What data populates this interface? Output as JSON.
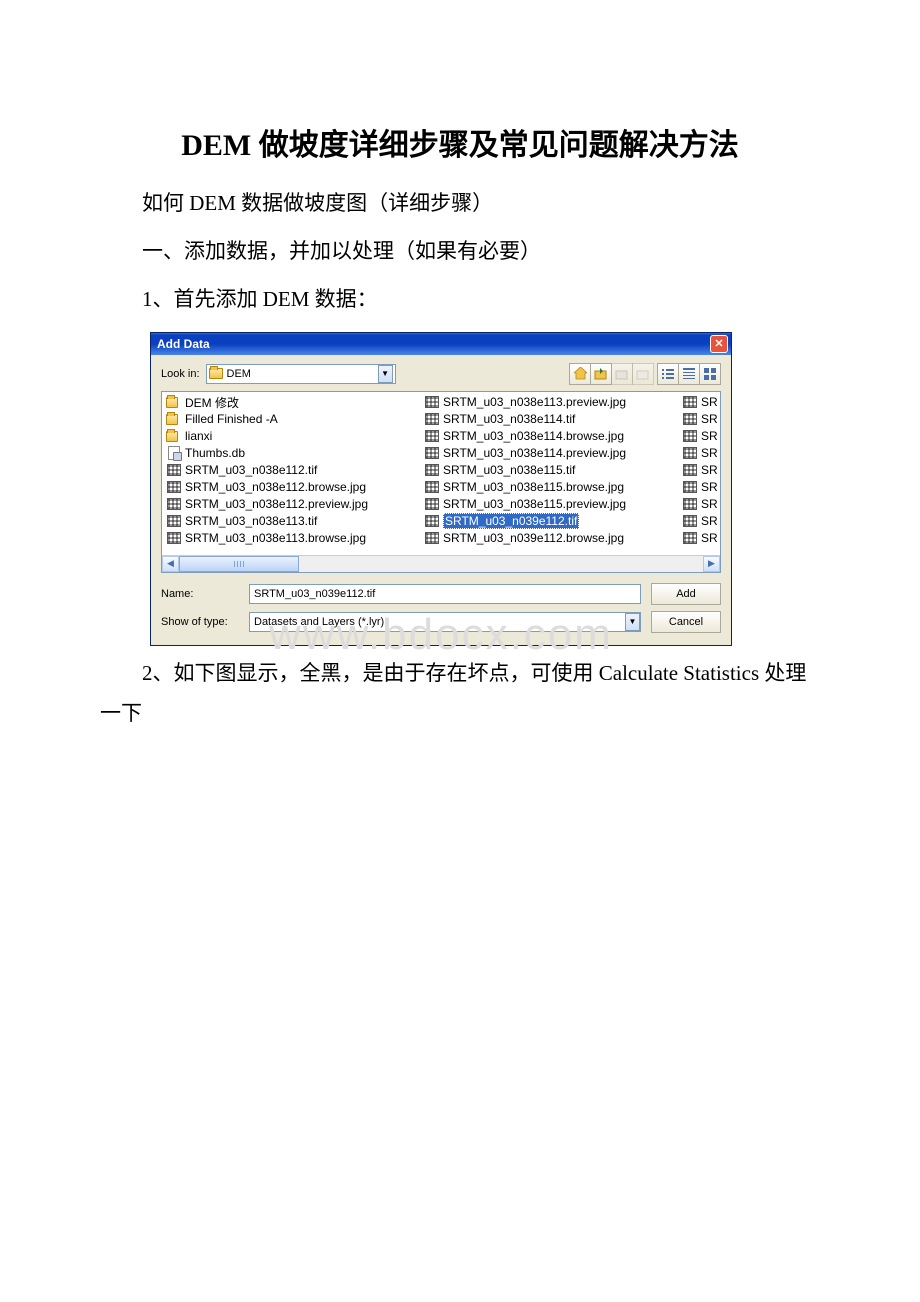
{
  "doc": {
    "title": "DEM 做坡度详细步骤及常见问题解决方法",
    "p1": "如何 DEM 数据做坡度图（详细步骤）",
    "p2": "一、添加数据，并加以处理（如果有必要）",
    "p3": "1、首先添加 DEM 数据：",
    "p4": "2、如下图显示，全黑，是由于存在坏点，可使用 Calculate Statistics 处理一下"
  },
  "watermark": "www.bdocx.com",
  "dialog": {
    "title": "Add Data",
    "lookin_label": "Look in:",
    "lookin_value": "DEM",
    "name_label": "Name:",
    "name_value": "SRTM_u03_n039e112.tif",
    "type_label": "Show of type:",
    "type_value": "Datasets and Layers (*.lyr)",
    "add": "Add",
    "cancel": "Cancel",
    "toolbar": {
      "up": "up-one-level-icon",
      "connect": "connect-folder-icon",
      "disconnect": "disconnect-folder-icon",
      "new": "new-folder-icon",
      "list": "list-view-icon",
      "details": "details-view-icon",
      "thumbs": "thumbnails-view-icon"
    },
    "files_col1": [
      {
        "icon": "folder",
        "name": "DEM 修改"
      },
      {
        "icon": "folder",
        "name": "Filled Finished -A"
      },
      {
        "icon": "folder",
        "name": "lianxi"
      },
      {
        "icon": "db",
        "name": "Thumbs.db"
      },
      {
        "icon": "raster",
        "name": "SRTM_u03_n038e112.tif"
      },
      {
        "icon": "raster",
        "name": "SRTM_u03_n038e112.browse.jpg"
      },
      {
        "icon": "raster",
        "name": "SRTM_u03_n038e112.preview.jpg"
      },
      {
        "icon": "raster",
        "name": "SRTM_u03_n038e113.tif"
      },
      {
        "icon": "raster",
        "name": "SRTM_u03_n038e113.browse.jpg"
      }
    ],
    "files_col2": [
      {
        "icon": "raster",
        "name": "SRTM_u03_n038e113.preview.jpg"
      },
      {
        "icon": "raster",
        "name": "SRTM_u03_n038e114.tif"
      },
      {
        "icon": "raster",
        "name": "SRTM_u03_n038e114.browse.jpg"
      },
      {
        "icon": "raster",
        "name": "SRTM_u03_n038e114.preview.jpg"
      },
      {
        "icon": "raster",
        "name": "SRTM_u03_n038e115.tif"
      },
      {
        "icon": "raster",
        "name": "SRTM_u03_n038e115.browse.jpg"
      },
      {
        "icon": "raster",
        "name": "SRTM_u03_n038e115.preview.jpg"
      },
      {
        "icon": "raster",
        "name": "SRTM_u03_n039e112.tif",
        "selected": true
      },
      {
        "icon": "raster",
        "name": "SRTM_u03_n039e112.browse.jpg"
      }
    ],
    "files_col3": [
      {
        "icon": "raster",
        "name": "SR"
      },
      {
        "icon": "raster",
        "name": "SR"
      },
      {
        "icon": "raster",
        "name": "SR"
      },
      {
        "icon": "raster",
        "name": "SR"
      },
      {
        "icon": "raster",
        "name": "SR"
      },
      {
        "icon": "raster",
        "name": "SR"
      },
      {
        "icon": "raster",
        "name": "SR"
      },
      {
        "icon": "raster",
        "name": "SR"
      },
      {
        "icon": "raster",
        "name": "SR"
      }
    ]
  }
}
